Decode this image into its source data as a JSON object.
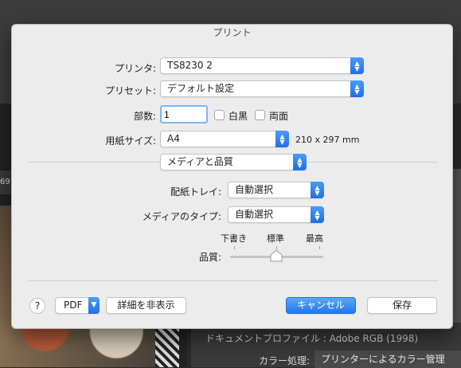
{
  "background": {
    "profile_text": "ドキュメントプロファイル : Adobe RGB (1998)",
    "color_label": "カラー処理:",
    "color_value": "プリンターによるカラー管理",
    "left_strip_text": "69"
  },
  "dialog": {
    "title": "プリント",
    "printer": {
      "label": "プリンタ:",
      "value": "TS8230 2"
    },
    "preset": {
      "label": "プリセット:",
      "value": "デフォルト設定"
    },
    "copies": {
      "label": "部数:",
      "value": "1"
    },
    "black_white": {
      "label": "白黒",
      "checked": false
    },
    "duplex": {
      "label": "両面",
      "checked": false
    },
    "paper_size": {
      "label": "用紙サイズ:",
      "value": "A4",
      "dimensions": "210 x 297 mm"
    },
    "section": {
      "value": "メディアと品質"
    },
    "paper_tray": {
      "label": "配紙トレイ:",
      "value": "自動選択"
    },
    "media_type": {
      "label": "メディアのタイプ:",
      "value": "自動選択"
    },
    "quality": {
      "label": "品質:",
      "ticks": [
        "下書き",
        "標準",
        "最高"
      ],
      "selected": "標準"
    },
    "buttons": {
      "help": "?",
      "pdf": "PDF",
      "hide_details": "詳細を非表示",
      "cancel": "キャンセル",
      "save": "保存"
    }
  }
}
